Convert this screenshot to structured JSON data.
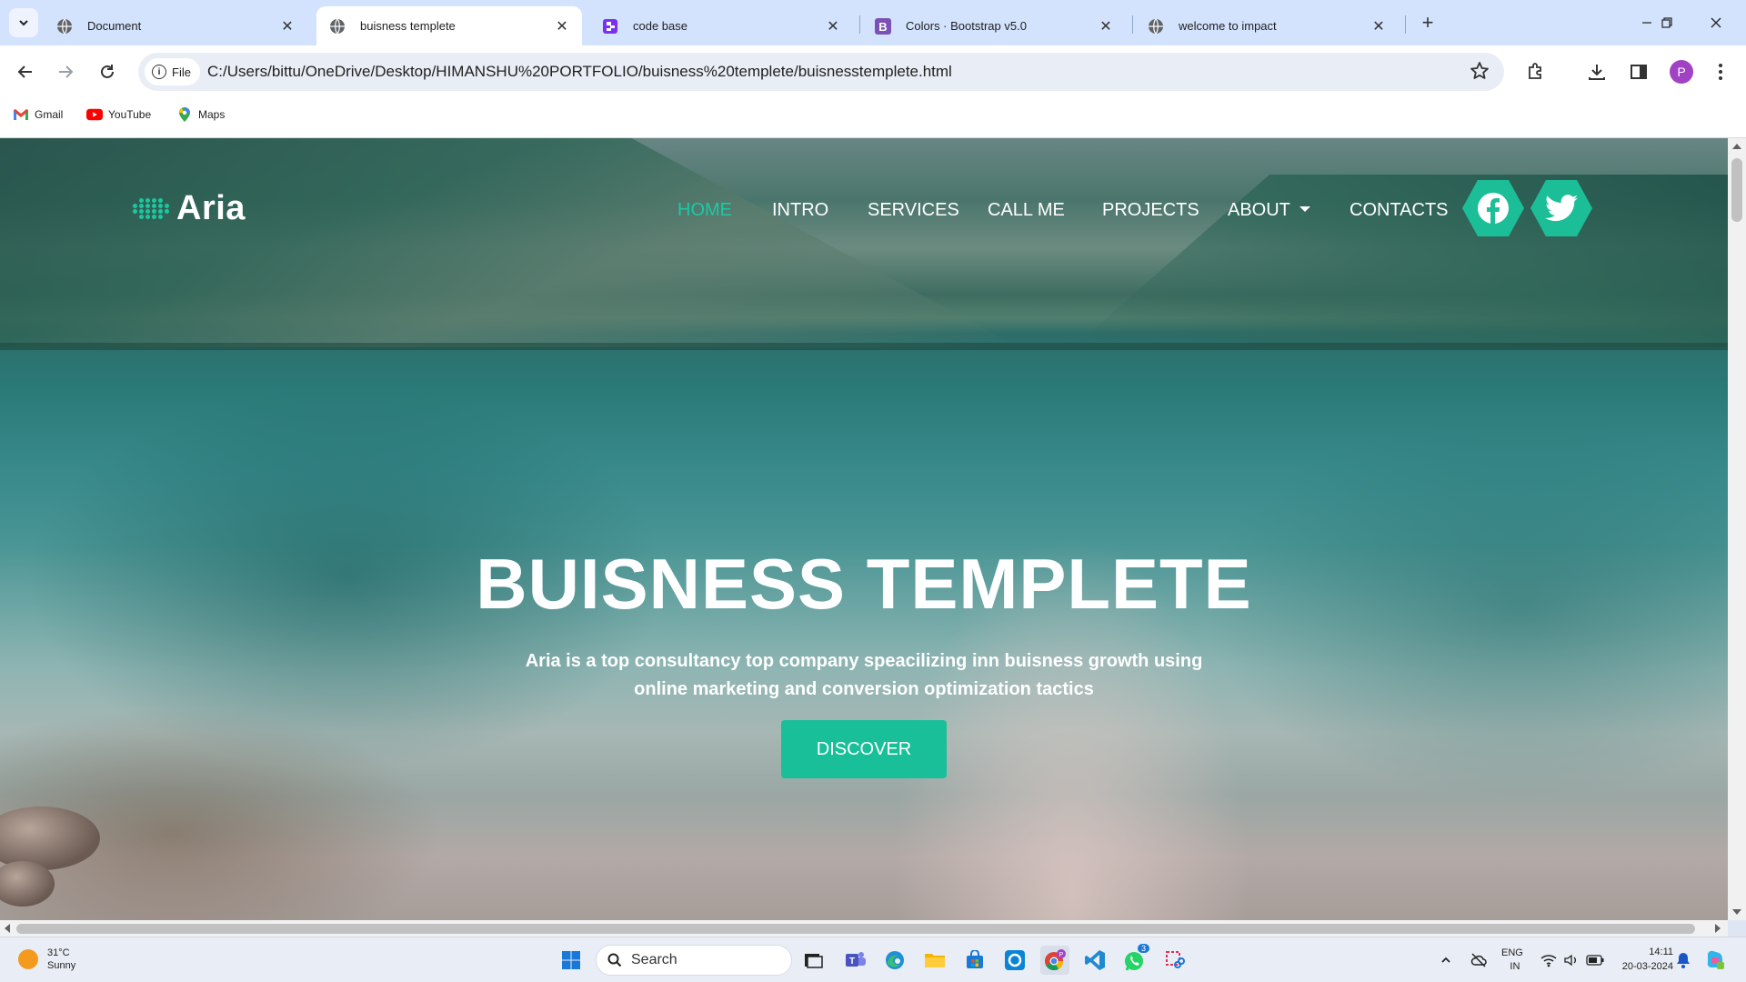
{
  "browser": {
    "tabs": [
      {
        "title": "Document",
        "favicon": "globe-icon",
        "active": false
      },
      {
        "title": "buisness templete",
        "favicon": "globe-icon",
        "active": true
      },
      {
        "title": "code base",
        "favicon": "replit-icon",
        "active": false
      },
      {
        "title": "Colors · Bootstrap v5.0",
        "favicon": "bootstrap-icon",
        "active": false
      },
      {
        "title": "welcome to impact",
        "favicon": "globe-icon",
        "active": false
      }
    ],
    "address": {
      "chip_label": "File",
      "url": "C:/Users/bittu/OneDrive/Desktop/HIMANSHU%20PORTFOLIO/buisness%20templete/buisnesstemplete.html"
    },
    "profile_initial": "P",
    "bookmarks": [
      {
        "label": "Gmail",
        "icon": "gmail-icon"
      },
      {
        "label": "YouTube",
        "icon": "youtube-icon"
      },
      {
        "label": "Maps",
        "icon": "maps-icon"
      }
    ]
  },
  "site": {
    "logo_text": "Aria",
    "nav": [
      {
        "label": "HOME",
        "active": true
      },
      {
        "label": "INTRO",
        "active": false
      },
      {
        "label": "SERVICES",
        "active": false
      },
      {
        "label": "CALL ME",
        "active": false
      },
      {
        "label": "PROJECTS",
        "active": false
      },
      {
        "label": "ABOUT",
        "active": false,
        "dropdown": true
      },
      {
        "label": "CONTACTS",
        "active": false
      }
    ],
    "social": [
      "facebook-icon",
      "twitter-icon"
    ],
    "hero": {
      "title": "BUISNESS TEMPLETE",
      "subtitle": "Aria is a top consultancy top company speacilizing inn buisness growth using online marketing and conversion optimization tactics",
      "button": "DISCOVER"
    },
    "colors": {
      "accent": "#1cbe98",
      "active_nav": "#1bc9a8"
    }
  },
  "taskbar": {
    "weather": {
      "temp": "31°C",
      "condition": "Sunny"
    },
    "search_placeholder": "Search",
    "lang_top": "ENG",
    "lang_bottom": "IN",
    "time": "14:11",
    "date": "20-03-2024",
    "whatsapp_badge": "3"
  }
}
